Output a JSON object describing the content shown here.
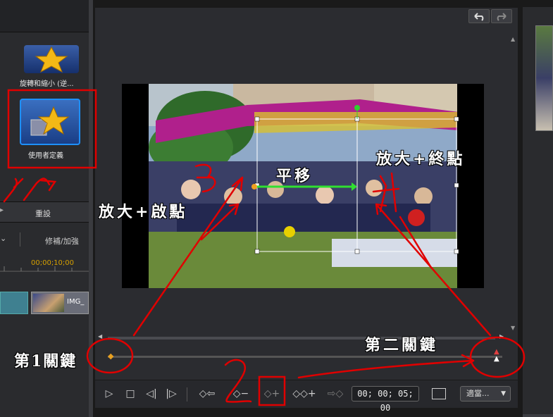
{
  "effects": {
    "rotate_zoom_label": "旋轉和縮小 (逆...",
    "custom_label": "使用者定義"
  },
  "left_panel": {
    "reset_label": "重設",
    "repair_label": "修補/加強",
    "ruler_time": "00;00;10;00",
    "clip_label": "IMG_"
  },
  "preview": {
    "timecode": "00; 00; 05; 00",
    "fit_label": "適當..."
  },
  "annotations": {
    "pan": "平移",
    "zoom_end": "放大+終點",
    "zoom_start": "放大+啟點",
    "first_key": "第1關鍵",
    "second_key": "第二關鍵"
  },
  "colors": {
    "annotation_red": "#e00000",
    "keyframe_gold": "#e8a020",
    "selection_blue": "#1e90ff",
    "timecode_gold": "#d6a000"
  }
}
